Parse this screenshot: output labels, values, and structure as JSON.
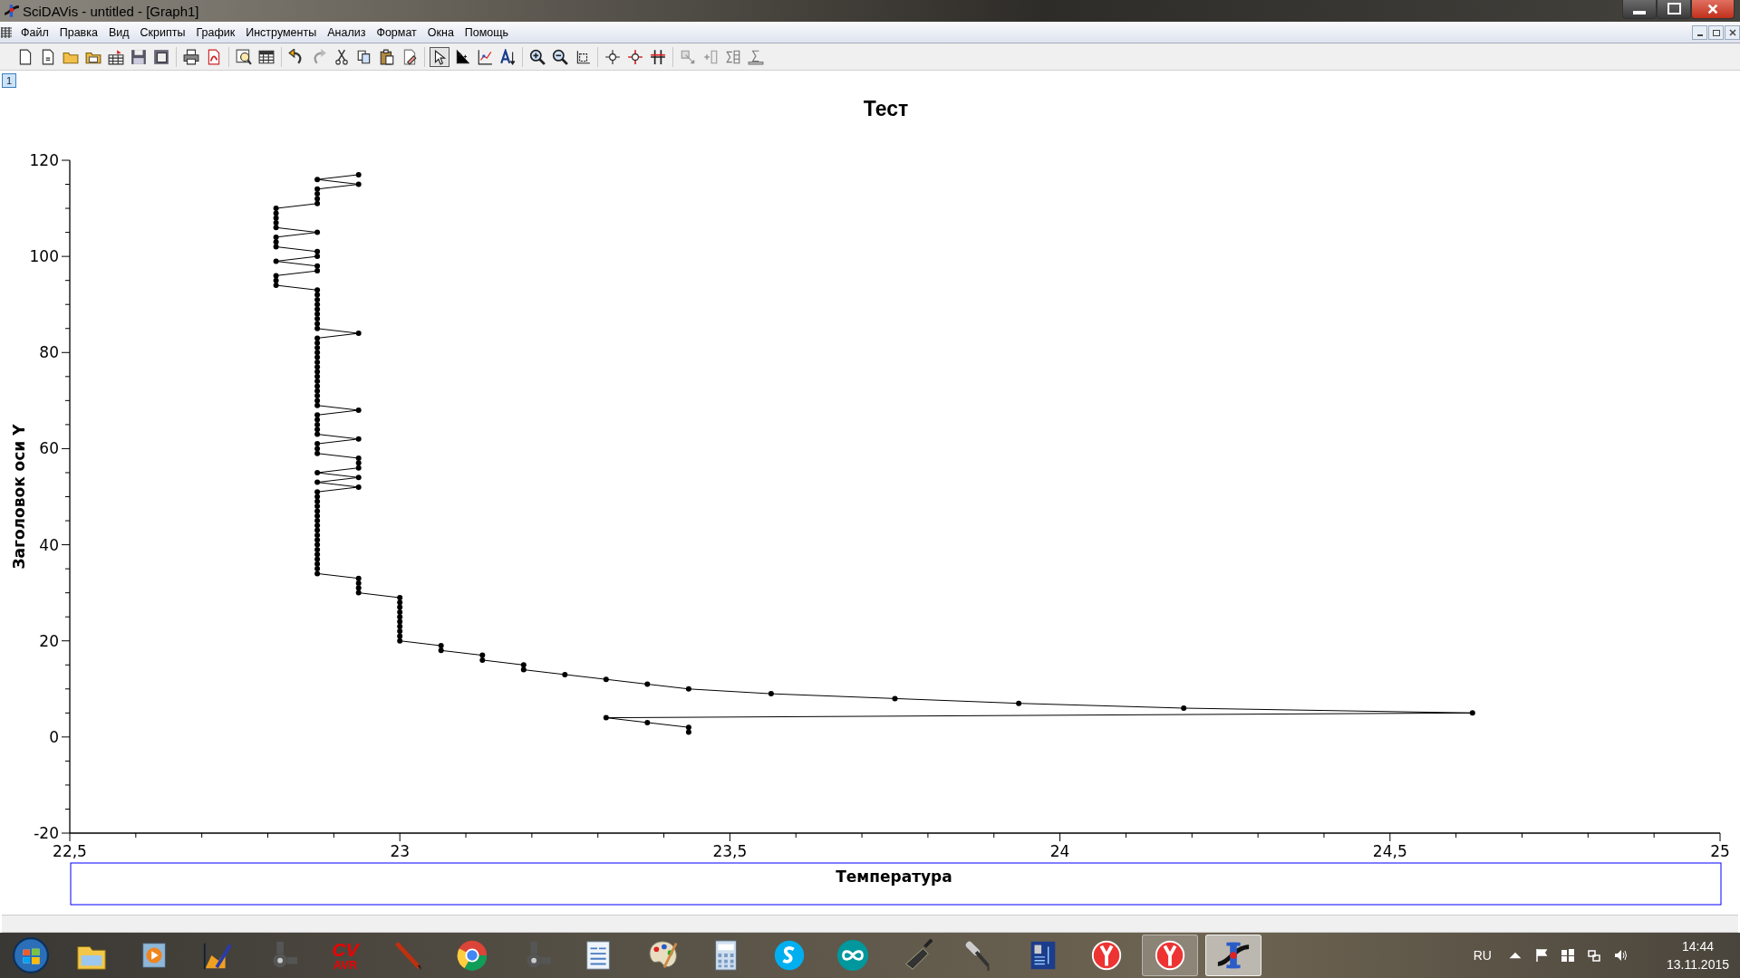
{
  "window": {
    "title": "SciDAVis - untitled - [Graph1]"
  },
  "menu": [
    "Файл",
    "Правка",
    "Вид",
    "Скрипты",
    "График",
    "Инструменты",
    "Анализ",
    "Формат",
    "Окна",
    "Помощь"
  ],
  "toolbar": {
    "tools": [
      {
        "selected": true
      },
      {
        "selected": false
      },
      {
        "selected": false
      },
      {
        "selected": false
      }
    ]
  },
  "graph": {
    "layer_button": "1",
    "chart_data": {
      "type": "line",
      "title": "Тест",
      "xlabel": "Температура",
      "ylabel": "Заголовок оси Y",
      "x": [
        22.9375,
        22.875,
        22.9375,
        22.875,
        22.875,
        22.875,
        22.875,
        22.8125,
        22.8125,
        22.8125,
        22.8125,
        22.8125,
        22.875,
        22.8125,
        22.8125,
        22.8125,
        22.875,
        22.875,
        22.8125,
        22.875,
        22.875,
        22.8125,
        22.8125,
        22.8125,
        22.875,
        22.875,
        22.875,
        22.875,
        22.875,
        22.875,
        22.875,
        22.875,
        22.875,
        22.9375,
        22.875,
        22.875,
        22.875,
        22.875,
        22.875,
        22.875,
        22.875,
        22.875,
        22.875,
        22.875,
        22.875,
        22.875,
        22.875,
        22.875,
        22.875,
        22.9375,
        22.875,
        22.875,
        22.875,
        22.875,
        22.875,
        22.9375,
        22.875,
        22.875,
        22.875,
        22.9375,
        22.9375,
        22.9375,
        22.875,
        22.9375,
        22.875,
        22.9375,
        22.875,
        22.875,
        22.875,
        22.875,
        22.875,
        22.875,
        22.875,
        22.875,
        22.875,
        22.875,
        22.875,
        22.875,
        22.875,
        22.875,
        22.875,
        22.875,
        22.875,
        22.875,
        22.9375,
        22.9375,
        22.9375,
        22.9375,
        23,
        23,
        23,
        23,
        23,
        23,
        23,
        23,
        23,
        23,
        23.0625,
        23.0625,
        23.125,
        23.125,
        23.1875,
        23.1875,
        23.25,
        23.3125,
        23.375,
        23.4375,
        23.5625,
        23.75,
        23.9375,
        24.1875,
        24.625,
        23.3125,
        23.375,
        23.4375,
        23.4375
      ],
      "series": [
        {
          "color": "#000000",
          "marker": "circle",
          "values": [
            117,
            116,
            115,
            114,
            113,
            112,
            111,
            110,
            109,
            108,
            107,
            106,
            105,
            104,
            103,
            102,
            101,
            100,
            99,
            98,
            97,
            96,
            95,
            94,
            93,
            92,
            91,
            90,
            89,
            88,
            87,
            86,
            85,
            84,
            83,
            82,
            81,
            80,
            79,
            78,
            77,
            76,
            75,
            74,
            73,
            72,
            71,
            70,
            69,
            68,
            67,
            66,
            65,
            64,
            63,
            62,
            61,
            60,
            59,
            58,
            57,
            56,
            55,
            54,
            53,
            52,
            51,
            50,
            49,
            48,
            47,
            46,
            45,
            44,
            43,
            42,
            41,
            40,
            39,
            38,
            37,
            36,
            35,
            34,
            33,
            32,
            31,
            30,
            29,
            28,
            27,
            26,
            25,
            24,
            23,
            22,
            21,
            20,
            19,
            18,
            17,
            16,
            15,
            14,
            13,
            12,
            11,
            10,
            9,
            8,
            7,
            6,
            5,
            4,
            3,
            2,
            1
          ]
        }
      ],
      "xlim": [
        22.5,
        25
      ],
      "ylim": [
        -20,
        120
      ],
      "xticks": [
        {
          "value": 22.5,
          "label": "22,5"
        },
        {
          "value": 23,
          "label": "23"
        },
        {
          "value": 23.5,
          "label": "23,5"
        },
        {
          "value": 24,
          "label": "24"
        },
        {
          "value": 24.5,
          "label": "24,5"
        },
        {
          "value": 25,
          "label": "25"
        }
      ],
      "yticks": [
        -20,
        0,
        20,
        40,
        60,
        80,
        100,
        120
      ]
    }
  },
  "taskbar": {
    "apps": [
      {
        "running": false,
        "selected": false
      },
      {
        "running": false,
        "selected": false
      },
      {
        "running": false,
        "selected": false
      },
      {
        "running": false,
        "selected": false
      },
      {
        "running": false,
        "selected": false,
        "logo_text": [
          "CV",
          "AVR"
        ]
      },
      {
        "running": false,
        "selected": false
      },
      {
        "running": false,
        "selected": false
      },
      {
        "running": false,
        "selected": false
      },
      {
        "running": false,
        "selected": false
      },
      {
        "running": false,
        "selected": false
      },
      {
        "running": false,
        "selected": false
      },
      {
        "running": false,
        "selected": false
      },
      {
        "running": false,
        "selected": false
      },
      {
        "running": false,
        "selected": false
      },
      {
        "running": false,
        "selected": false
      },
      {
        "running": false,
        "selected": false
      },
      {
        "running": false,
        "selected": false
      },
      {
        "running": true,
        "selected": false
      },
      {
        "running": true,
        "selected": true
      }
    ],
    "language": "RU",
    "time": "14:44",
    "date": "13.11.2015"
  }
}
